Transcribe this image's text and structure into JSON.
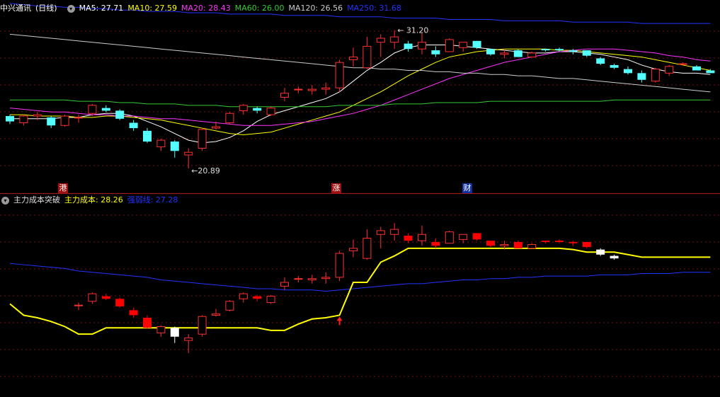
{
  "stock": {
    "name": "中兴通讯",
    "period": "(日线)"
  },
  "price_panel": {
    "ma": [
      {
        "label": "MA5: 27.71",
        "color": "#ffffff"
      },
      {
        "label": "MA10: 27.59",
        "color": "#ffff00"
      },
      {
        "label": "MA20: 28.43",
        "color": "#ff33ff"
      },
      {
        "label": "MA60: 26.00",
        "color": "#33cc33"
      },
      {
        "label": "MA120: 26.56",
        "color": "#cccccc"
      },
      {
        "label": "MA250: 31.68",
        "color": "#2233ff"
      }
    ],
    "high_label": "31.20",
    "low_label": "20.89",
    "events": [
      {
        "label": "港",
        "color": "#a01010"
      },
      {
        "label": "涨",
        "color": "#a01010"
      },
      {
        "label": "财",
        "color": "#1030a0"
      }
    ]
  },
  "indicator_panel": {
    "title": "主力成本突破",
    "items": [
      {
        "label": "主力成本: 28.26",
        "color": "#ffff00"
      },
      {
        "label": "强弱线: 27.28",
        "color": "#2233ff"
      }
    ]
  },
  "colors": {
    "up": "#ff3030",
    "down": "#54ffff",
    "bg": "#000000",
    "grid": "#7a1010",
    "cost_up": "#ff0000",
    "cost_down": "#ffffff"
  },
  "chart_data": [
    {
      "type": "candlestick",
      "title": "中兴通讯 (日线)",
      "ohlc": [
        [
          24.8,
          24.9,
          24.2,
          24.4
        ],
        [
          24.3,
          24.9,
          24.1,
          24.8
        ],
        [
          24.8,
          25.1,
          24.5,
          24.9
        ],
        [
          24.7,
          24.8,
          23.9,
          24.1
        ],
        [
          24.1,
          24.9,
          24.0,
          24.8
        ],
        [
          24.7,
          24.9,
          24.3,
          24.7
        ],
        [
          25.0,
          25.7,
          24.8,
          25.6
        ],
        [
          25.4,
          25.6,
          25.1,
          25.2
        ],
        [
          25.2,
          25.3,
          24.5,
          24.6
        ],
        [
          24.3,
          24.5,
          23.7,
          23.9
        ],
        [
          23.7,
          23.9,
          22.8,
          22.9
        ],
        [
          22.5,
          23.1,
          22.2,
          23.0
        ],
        [
          22.9,
          23.0,
          21.7,
          22.2
        ],
        [
          21.9,
          22.4,
          20.9,
          22.1
        ],
        [
          22.4,
          23.9,
          22.2,
          23.8
        ],
        [
          23.9,
          24.4,
          23.8,
          24.0
        ],
        [
          24.3,
          25.1,
          24.2,
          25.0
        ],
        [
          25.2,
          25.7,
          24.9,
          25.6
        ],
        [
          25.4,
          25.5,
          25.0,
          25.2
        ],
        [
          24.9,
          25.5,
          24.8,
          25.4
        ],
        [
          26.2,
          26.9,
          25.9,
          26.5
        ],
        [
          26.8,
          27.0,
          26.5,
          26.8
        ],
        [
          26.7,
          27.1,
          26.4,
          26.8
        ],
        [
          26.8,
          27.3,
          26.4,
          26.9
        ],
        [
          26.9,
          29.0,
          26.6,
          28.8
        ],
        [
          29.0,
          29.9,
          28.5,
          29.2
        ],
        [
          28.4,
          30.7,
          28.3,
          30.0
        ],
        [
          30.3,
          30.9,
          29.2,
          30.6
        ],
        [
          30.3,
          31.2,
          29.8,
          30.7
        ],
        [
          30.2,
          30.4,
          29.6,
          29.8
        ],
        [
          29.8,
          31.0,
          29.4,
          30.3
        ],
        [
          29.7,
          30.0,
          29.2,
          29.4
        ],
        [
          29.6,
          30.6,
          29.6,
          30.5
        ],
        [
          29.9,
          30.3,
          29.6,
          30.3
        ],
        [
          30.4,
          30.4,
          29.8,
          29.9
        ],
        [
          29.8,
          29.8,
          29.3,
          29.4
        ],
        [
          29.4,
          29.8,
          29.1,
          29.5
        ],
        [
          29.7,
          29.8,
          29.2,
          29.2
        ],
        [
          29.2,
          29.6,
          29.2,
          29.5
        ],
        [
          29.8,
          29.8,
          29.6,
          29.7
        ],
        [
          29.8,
          29.9,
          29.6,
          29.7
        ],
        [
          29.7,
          29.8,
          29.4,
          29.6
        ],
        [
          29.7,
          29.7,
          29.2,
          29.3
        ],
        [
          29.1,
          29.2,
          28.6,
          28.7
        ],
        [
          28.6,
          28.7,
          28.3,
          28.4
        ],
        [
          28.3,
          28.5,
          27.9,
          28.0
        ],
        [
          28.0,
          28.2,
          27.3,
          27.5
        ],
        [
          27.4,
          28.4,
          27.3,
          28.3
        ],
        [
          28.0,
          28.6,
          27.8,
          28.5
        ],
        [
          28.7,
          28.8,
          28.6,
          28.7
        ],
        [
          28.5,
          28.6,
          28.2,
          28.2
        ],
        [
          28.2,
          28.3,
          28.0,
          28.0
        ]
      ],
      "ylim": [
        20.0,
        32.5
      ],
      "lines": {
        "MA5": [
          24.6,
          24.6,
          24.6,
          24.6,
          24.7,
          24.7,
          24.9,
          25.0,
          25.0,
          24.8,
          24.4,
          24.0,
          23.5,
          23.0,
          22.8,
          22.9,
          23.2,
          23.7,
          24.4,
          24.9,
          25.2,
          25.5,
          25.8,
          26.1,
          26.6,
          27.4,
          28.2,
          28.8,
          29.5,
          29.9,
          30.1,
          30.1,
          30.1,
          30.0,
          29.9,
          29.8,
          29.7,
          29.6,
          29.5,
          29.5,
          29.6,
          29.6,
          29.5,
          29.4,
          29.2,
          29.0,
          28.6,
          28.3,
          28.1,
          28.0,
          28.0,
          27.9
        ],
        "MA10": [
          24.9,
          24.9,
          24.8,
          24.8,
          24.8,
          24.7,
          24.7,
          24.8,
          24.8,
          24.7,
          24.6,
          24.5,
          24.3,
          24.1,
          23.9,
          23.7,
          23.5,
          23.4,
          23.5,
          23.6,
          23.9,
          24.2,
          24.5,
          24.8,
          25.1,
          25.6,
          26.1,
          26.6,
          27.2,
          27.8,
          28.3,
          28.8,
          29.2,
          29.4,
          29.6,
          29.7,
          29.8,
          29.8,
          29.8,
          29.8,
          29.7,
          29.7,
          29.6,
          29.5,
          29.4,
          29.3,
          29.2,
          29.0,
          28.8,
          28.6,
          28.4,
          28.2
        ],
        "MA20": [
          25.4,
          25.3,
          25.2,
          25.1,
          25.1,
          25.0,
          24.9,
          24.9,
          24.8,
          24.8,
          24.7,
          24.6,
          24.6,
          24.5,
          24.4,
          24.3,
          24.2,
          24.1,
          24.1,
          24.1,
          24.2,
          24.3,
          24.4,
          24.6,
          24.8,
          25.0,
          25.3,
          25.6,
          26.0,
          26.4,
          26.8,
          27.2,
          27.6,
          27.9,
          28.2,
          28.5,
          28.8,
          29.0,
          29.2,
          29.4,
          29.6,
          29.7,
          29.8,
          29.8,
          29.8,
          29.7,
          29.6,
          29.5,
          29.3,
          29.2,
          29.0,
          28.9
        ],
        "MA60": [
          26.0,
          26.0,
          26.0,
          26.0,
          26.0,
          25.9,
          25.9,
          25.9,
          25.8,
          25.8,
          25.7,
          25.7,
          25.7,
          25.6,
          25.6,
          25.6,
          25.5,
          25.5,
          25.5,
          25.5,
          25.5,
          25.5,
          25.5,
          25.5,
          25.6,
          25.6,
          25.6,
          25.6,
          25.7,
          25.7,
          25.7,
          25.8,
          25.8,
          25.8,
          25.8,
          25.9,
          25.9,
          25.9,
          25.9,
          25.9,
          25.9,
          25.9,
          25.9,
          25.9,
          26.0,
          26.0,
          26.0,
          26.0,
          26.0,
          26.0,
          26.0,
          26.0
        ],
        "MA120": [
          30.9,
          30.8,
          30.7,
          30.6,
          30.5,
          30.4,
          30.3,
          30.2,
          30.1,
          30.0,
          29.9,
          29.8,
          29.7,
          29.6,
          29.5,
          29.4,
          29.3,
          29.2,
          29.1,
          29.0,
          28.9,
          28.8,
          28.7,
          28.6,
          28.5,
          28.4,
          28.4,
          28.3,
          28.3,
          28.2,
          28.2,
          28.1,
          28.1,
          28.0,
          28.0,
          27.9,
          27.9,
          27.8,
          27.8,
          27.7,
          27.6,
          27.6,
          27.5,
          27.4,
          27.3,
          27.2,
          27.1,
          27.0,
          26.9,
          26.8,
          26.7,
          26.6
        ],
        "MA250": [
          33.2,
          33.1,
          33.0,
          33.0,
          32.9,
          32.9,
          32.8,
          32.8,
          32.7,
          32.7,
          32.6,
          32.6,
          32.6,
          32.5,
          32.5,
          32.5,
          32.4,
          32.4,
          32.4,
          32.4,
          32.3,
          32.3,
          32.3,
          32.3,
          32.2,
          32.2,
          32.2,
          32.2,
          32.1,
          32.1,
          32.1,
          32.1,
          32.0,
          32.0,
          32.0,
          32.0,
          31.9,
          31.9,
          31.9,
          31.9,
          31.9,
          31.8,
          31.8,
          31.8,
          31.8,
          31.8,
          31.7,
          31.7,
          31.7,
          31.7,
          31.7,
          31.7
        ]
      }
    },
    {
      "type": "line",
      "title": "主力成本突破",
      "ylim": [
        20.0,
        32.5
      ],
      "series": [
        {
          "name": "主力成本",
          "values": [
            24.8,
            23.9,
            23.7,
            23.4,
            23.0,
            22.4,
            22.4,
            22.9,
            22.9,
            22.9,
            22.9,
            22.9,
            22.9,
            22.9,
            22.9,
            22.9,
            22.9,
            22.9,
            22.9,
            22.7,
            22.7,
            23.2,
            23.6,
            23.7,
            23.9,
            26.5,
            26.5,
            28.1,
            28.6,
            29.2,
            29.2,
            29.2,
            29.2,
            29.2,
            29.2,
            29.2,
            29.2,
            29.2,
            29.2,
            29.2,
            29.2,
            29.1,
            28.9,
            28.9,
            28.9,
            28.7,
            28.5,
            28.5,
            28.5,
            28.5,
            28.5,
            28.5
          ]
        },
        {
          "name": "强弱线",
          "values": [
            28.0,
            27.9,
            27.8,
            27.7,
            27.6,
            27.4,
            27.3,
            27.2,
            27.1,
            27.0,
            26.9,
            26.7,
            26.6,
            26.5,
            26.4,
            26.3,
            26.2,
            26.1,
            26.0,
            26.0,
            25.9,
            25.9,
            25.9,
            25.8,
            25.9,
            26.0,
            26.1,
            26.2,
            26.3,
            26.4,
            26.4,
            26.5,
            26.6,
            26.7,
            26.7,
            26.8,
            26.8,
            26.9,
            26.9,
            27.0,
            27.0,
            27.0,
            27.0,
            27.1,
            27.1,
            27.1,
            27.2,
            27.2,
            27.2,
            27.3,
            27.3,
            27.3
          ]
        }
      ],
      "candle_window": [
        5,
        44
      ],
      "arrow_index": 24
    }
  ]
}
